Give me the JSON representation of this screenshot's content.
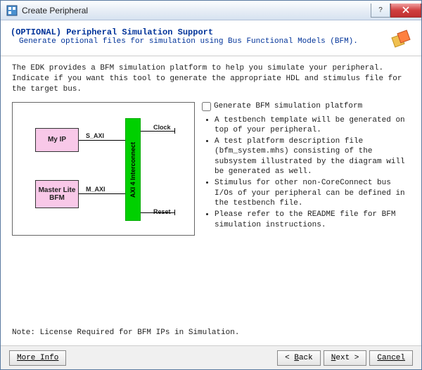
{
  "window": {
    "title": "Create Peripheral"
  },
  "header": {
    "title": "(OPTIONAL) Peripheral Simulation Support",
    "subtitle": "Generate optional files for simulation using Bus Functional Models (BFM)."
  },
  "intro": "The EDK provides a BFM simulation platform to help you simulate your peripheral. Indicate if you want this tool to generate the appropriate HDL and stimulus file for the target bus.",
  "checkbox": {
    "label": "Generate BFM simulation platform"
  },
  "bullets": [
    "A testbench template will be generated on top of your peripheral.",
    "A test platform description file (bfm_system.mhs) consisting of the subsystem illustrated by the diagram will be generated as well.",
    "Stimulus for other non-CoreConnect bus I/Os of your peripheral can be defined in the testbench file.",
    "Please refer to the README file for BFM simulation instructions."
  ],
  "diagram": {
    "myip": "My IP",
    "master": "Master Lite\nBFM",
    "interconnect": "AXI 4 Interconnect",
    "s_axi": "S_AXI",
    "m_axi": "M_AXI",
    "clock": "Clock",
    "reset": "Reset"
  },
  "note": "Note: License Required for BFM IPs in Simulation.",
  "buttons": {
    "more_info": "More Info",
    "back": "< Back",
    "next": "Next >",
    "cancel": "Cancel"
  }
}
